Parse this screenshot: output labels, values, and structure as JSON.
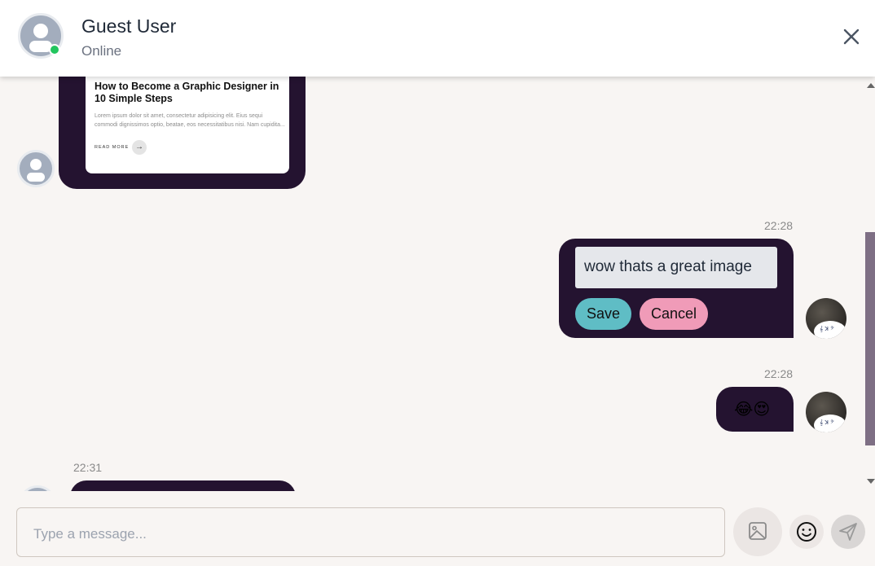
{
  "header": {
    "name": "Guest User",
    "status": "Online"
  },
  "link_card": {
    "title": "How to Become a Graphic Designer in 10 Simple Steps",
    "excerpt": "Lorem ipsum dolor sit amet, consectetur adipisicing elit. Eius sequi commodi dignissimos optio, beatae, eos necessitatibus nisi. Nam cupidita...",
    "read_more": "READ MORE"
  },
  "messages": {
    "edit": {
      "time": "22:28",
      "value": "wow thats a great image",
      "save_label": "Save",
      "cancel_label": "Cancel"
    },
    "emoji_msg": {
      "time": "22:28",
      "emojis": "😂😍"
    },
    "guest_msg": {
      "time": "22:31"
    }
  },
  "composer": {
    "placeholder": "Type a message..."
  },
  "icons": {
    "close": "close-icon",
    "image": "image-icon",
    "emoji": "smiley-icon",
    "send": "send-icon"
  },
  "colors": {
    "bubble": "#241330",
    "save": "#5fbdc5",
    "cancel": "#f09bb8",
    "online": "#22c55e",
    "scroll_thumb": "#7e6f84"
  }
}
